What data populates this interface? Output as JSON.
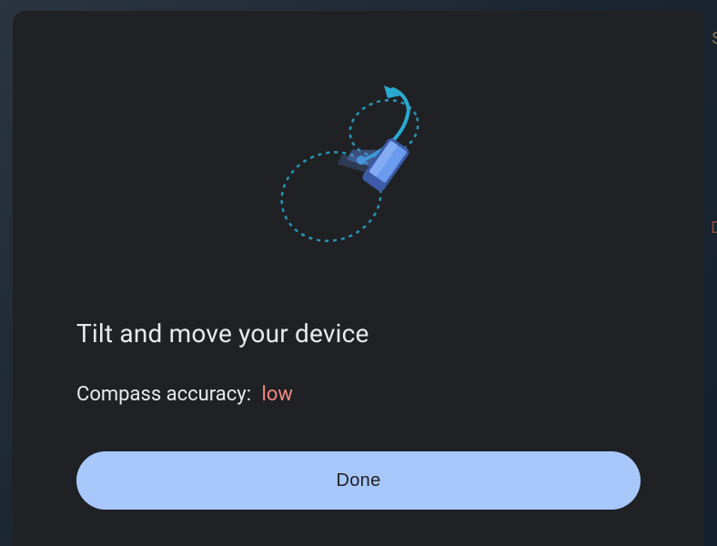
{
  "modal": {
    "title": "Tilt and move your device",
    "accuracy_label": "Compass accuracy:",
    "accuracy_value": "low",
    "done_label": "Done"
  },
  "colors": {
    "card_bg": "#202124",
    "text_primary": "#e8eaed",
    "accuracy_low": "#f28b82",
    "button_bg": "#a8c7fa",
    "button_text": "#202124",
    "figure_stroke": "#2aa9cf",
    "phone_fill": "#5a86e0"
  }
}
